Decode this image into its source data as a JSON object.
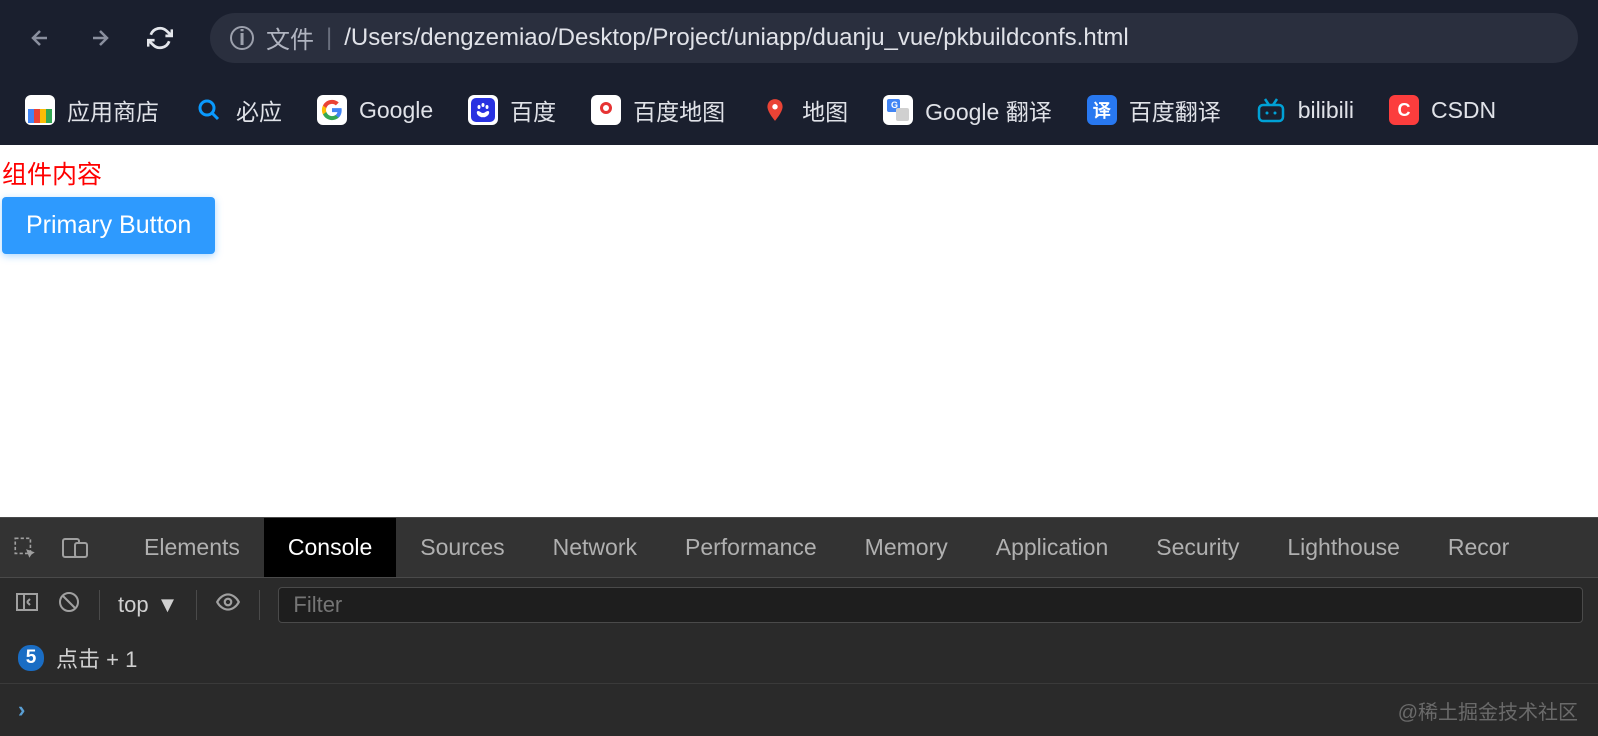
{
  "browser": {
    "url_label": "文件",
    "url_path": "/Users/dengzemiao/Desktop/Project/uniapp/duanju_vue/pkbuildconfs.html"
  },
  "bookmarks": [
    {
      "label": "应用商店",
      "icon": "store"
    },
    {
      "label": "必应",
      "icon": "bing"
    },
    {
      "label": "Google",
      "icon": "google"
    },
    {
      "label": "百度",
      "icon": "baidu"
    },
    {
      "label": "百度地图",
      "icon": "baidumap"
    },
    {
      "label": "地图",
      "icon": "map"
    },
    {
      "label": "Google 翻译",
      "icon": "gtranslate"
    },
    {
      "label": "百度翻译",
      "icon": "btranslate"
    },
    {
      "label": "bilibili",
      "icon": "bilibili"
    },
    {
      "label": "CSDN",
      "icon": "csdn"
    }
  ],
  "content": {
    "component_label": "组件内容",
    "button_label": "Primary Button"
  },
  "devtools": {
    "tabs": [
      "Elements",
      "Console",
      "Sources",
      "Network",
      "Performance",
      "Memory",
      "Application",
      "Security",
      "Lighthouse",
      "Recor"
    ],
    "active_tab": "Console",
    "context": "top",
    "filter_placeholder": "Filter",
    "log": {
      "count": "5",
      "message": "点击  +  1"
    },
    "watermark": "@稀土掘金技术社区"
  }
}
